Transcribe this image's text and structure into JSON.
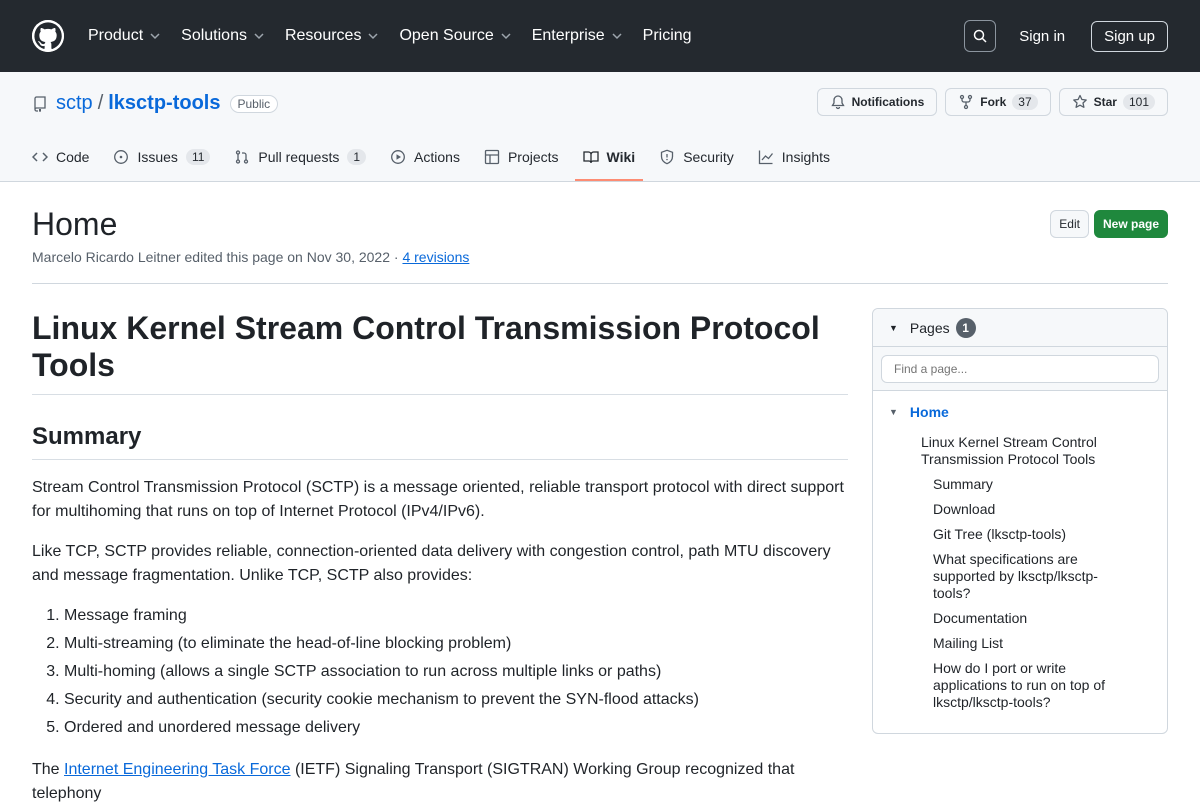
{
  "header": {
    "nav": [
      {
        "label": "Product",
        "dropdown": true
      },
      {
        "label": "Solutions",
        "dropdown": true
      },
      {
        "label": "Resources",
        "dropdown": true
      },
      {
        "label": "Open Source",
        "dropdown": true
      },
      {
        "label": "Enterprise",
        "dropdown": true
      },
      {
        "label": "Pricing",
        "dropdown": false
      }
    ],
    "signin": "Sign in",
    "signup": "Sign up"
  },
  "repo": {
    "owner": "sctp",
    "name": "lksctp-tools",
    "visibility": "Public",
    "notifications": "Notifications",
    "fork_label": "Fork",
    "fork_count": "37",
    "star_label": "Star",
    "star_count": "101"
  },
  "tabs": [
    {
      "label": "Code",
      "count": null,
      "icon": "code-icon"
    },
    {
      "label": "Issues",
      "count": "11",
      "icon": "issue-icon"
    },
    {
      "label": "Pull requests",
      "count": "1",
      "icon": "pull-request-icon"
    },
    {
      "label": "Actions",
      "count": null,
      "icon": "play-icon"
    },
    {
      "label": "Projects",
      "count": null,
      "icon": "table-icon"
    },
    {
      "label": "Wiki",
      "count": null,
      "icon": "book-icon",
      "active": true
    },
    {
      "label": "Security",
      "count": null,
      "icon": "shield-icon"
    },
    {
      "label": "Insights",
      "count": null,
      "icon": "graph-icon"
    }
  ],
  "page": {
    "title": "Home",
    "meta_text": "Marcelo Ricardo Leitner edited this page on Nov 30, 2022 · ",
    "revisions": "4 revisions",
    "edit": "Edit",
    "new_page": "New page"
  },
  "content": {
    "h1": "Linux Kernel Stream Control Transmission Protocol Tools",
    "h2": "Summary",
    "p1": "Stream Control Transmission Protocol (SCTP) is a message oriented, reliable transport protocol with direct support for multihoming that runs on top of Internet Protocol (IPv4/IPv6).",
    "p2": "Like TCP, SCTP provides reliable, connection-oriented data delivery with congestion control, path MTU discovery and message fragmentation. Unlike TCP, SCTP also provides:",
    "list": [
      "Message framing",
      "Multi-streaming (to eliminate the head-of-line blocking problem)",
      "Multi-homing (allows a single SCTP association to run across multiple links or paths)",
      "Security and authentication (security cookie mechanism to prevent the SYN-flood attacks)",
      "Ordered and unordered message delivery"
    ],
    "p3_pre": "The ",
    "p3_link": "Internet Engineering Task Force",
    "p3_post": " (IETF) Signaling Transport (SIGTRAN) Working Group recognized that telephony"
  },
  "sidebar": {
    "title": "Pages",
    "count": "1",
    "search_placeholder": "Find a page...",
    "home": "Home",
    "section": "Linux Kernel Stream Control Transmission Protocol Tools",
    "items": [
      "Summary",
      "Download",
      "Git Tree (lksctp-tools)",
      "What specifications are supported by lksctp/lksctp-tools?",
      "Documentation",
      "Mailing List",
      "How do I port or write applications to run on top of lksctp/lksctp-tools?"
    ]
  }
}
